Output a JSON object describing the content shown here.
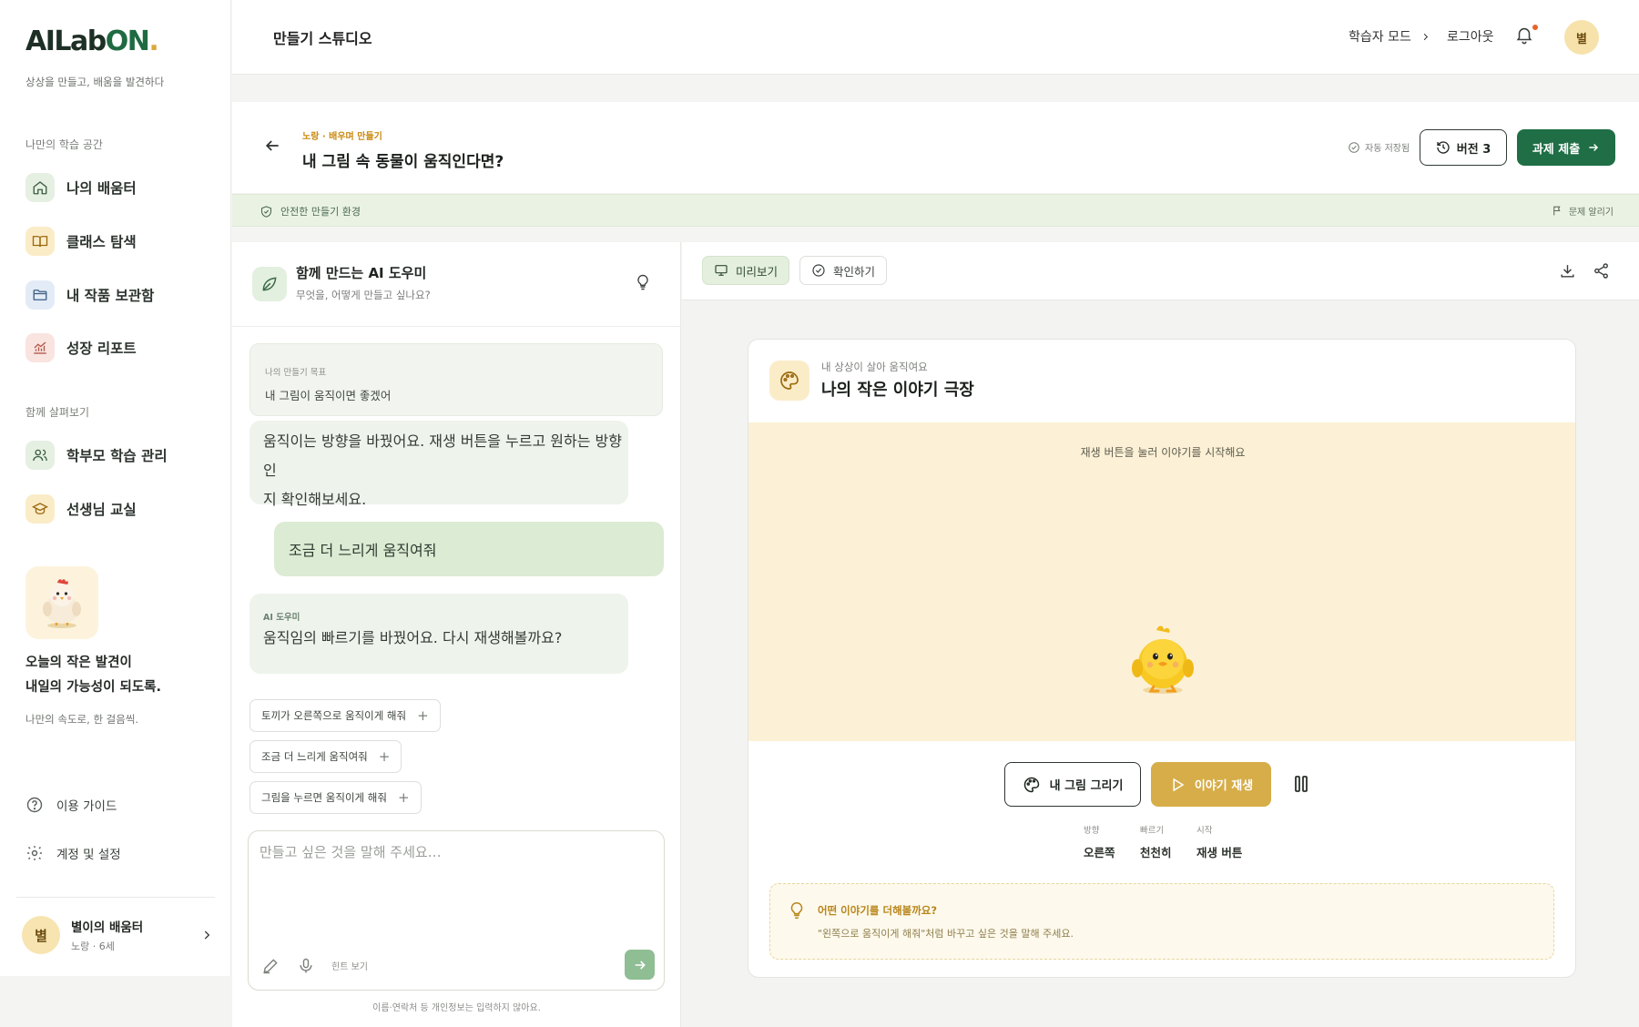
{
  "brand": {
    "logo_main": "AILab",
    "logo_on": "ON",
    "logo_dot": ".",
    "tagline": "상상을 만들고, 배움을 발견하다"
  },
  "sidebar": {
    "section_my": "나만의 학습 공간",
    "items_my": [
      {
        "label": "나의 배움터",
        "icon": "home-icon",
        "color": "#e6f0e2"
      },
      {
        "label": "클래스 탐색",
        "icon": "book-open-icon",
        "color": "#fbecc8"
      },
      {
        "label": "내 작품 보관함",
        "icon": "folder-icon",
        "color": "#e3ecf6"
      },
      {
        "label": "성장 리포트",
        "icon": "chart-icon",
        "color": "#f9e4e0"
      }
    ],
    "section_together": "함께 살펴보기",
    "items_together": [
      {
        "label": "학부모 학습 관리",
        "icon": "users-icon",
        "color": "#e6f0e2"
      },
      {
        "label": "선생님 교실",
        "icon": "graduation-cap-icon",
        "color": "#fbecc8"
      }
    ],
    "quote_line1": "오늘의 작은 발견이",
    "quote_line2": "내일의 가능성이 되도록.",
    "quote_sub": "나만의 속도로, 한 걸음씩.",
    "util_guide": "이용 가이드",
    "util_settings": "계정 및 설정",
    "profile_avatar": "별",
    "profile_name": "별이의 배움터",
    "profile_meta": "노랑 · 6세"
  },
  "topbar": {
    "title": "만들기 스튜디오",
    "learner_mode": "학습자 모드",
    "logout": "로그아웃",
    "avatar": "별"
  },
  "header": {
    "breadcrumb": "노랑 · 배우며 만들기",
    "title": "내 그림 속 동물이 움직인다면?",
    "autosave": "자동 저장됨",
    "version": "버전 3",
    "submit": "과제 제출",
    "safe_env": "안전한 만들기 환경",
    "report": "문제 알리기"
  },
  "chat": {
    "ai_name": "함께 만드는 AI 도우미",
    "ai_sub": "무엇을, 어떻게 만들고 싶나요?",
    "goal_label": "나의 만들기 목표",
    "goal_text": "내 그림이 움직이면 좋겠어",
    "messages": [
      {
        "role": "ai",
        "text_line1": "움직이는 방향을 바꿨어요. 재생 버튼을 누르고 원하는 방향인",
        "text_line2": "지 확인해보세요."
      },
      {
        "role": "user",
        "text": "조금 더 느리게 움직여줘"
      },
      {
        "role": "ai",
        "who": "AI 도우미",
        "text": "움직임의 빠르기를 바꿨어요. 다시 재생해볼까요?"
      }
    ],
    "suggestions": [
      "토끼가 오른쪽으로 움직이게 해줘",
      "조금 더 느리게 움직여줘",
      "그림을 누르면 움직이게 해줘"
    ],
    "input_placeholder": "만들고 싶은 것을 말해 주세요…",
    "hint": "힌트 보기",
    "privacy": "이름·연락처 등 개인정보는 입력하지 않아요."
  },
  "preview": {
    "tab_preview": "미리보기",
    "tab_check": "확인하기",
    "kicker": "내 상상이 살아 움직여요",
    "title": "나의 작은 이야기 극장",
    "stage_hint": "재생 버튼을 눌러 이야기를 시작해요",
    "draw_btn": "내 그림 그리기",
    "play_btn": "이야기 재생",
    "stats": [
      {
        "k": "방향",
        "v": "오른쪽"
      },
      {
        "k": "빠르기",
        "v": "천천히"
      },
      {
        "k": "시작",
        "v": "재생 버튼"
      }
    ],
    "idea_title": "어떤 이야기를 더해볼까요?",
    "idea_text": "\"왼쪽으로 움직이게 해줘\"처럼 바꾸고 싶은 것을 말해 주세요."
  },
  "colors": {
    "primary": "#1f6e45",
    "accent": "#d6ad48",
    "stage_bg": "#fcf1d6"
  }
}
